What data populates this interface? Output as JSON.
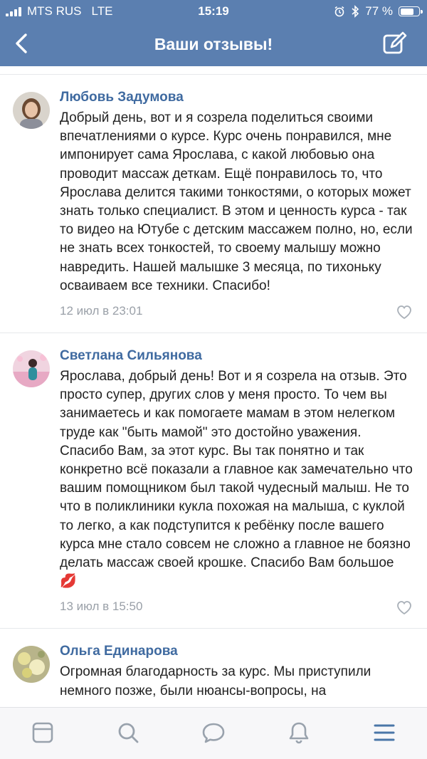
{
  "status_bar": {
    "carrier": "MTS RUS",
    "network": "LTE",
    "time": "15:19",
    "battery_percent": "77 %",
    "battery_level": 0.77
  },
  "nav": {
    "title": "Ваши отзывы!",
    "back_icon": "chevron-left-icon",
    "edit_icon": "compose-icon"
  },
  "reviews": [
    {
      "author": "Любовь Задумова",
      "text": "Добрый день, вот и я созрела поделиться своими впечатлениями о курсе. Курс очень понравился, мне импонирует сама Ярослава, с какой любовью она проводит массаж деткам. Ещё понравилось то, что Ярослава делится такими тонкостями, о которых может знать только специалист. В этом и ценность курса - так то видео на Ютубе с детским массажем полно, но, если не знать всех тонкостей, то своему малышу можно навредить. Нашей малышке 3 месяца, по тихоньку осваиваем все техники. Спасибо!",
      "date": "12 июл в 23:01"
    },
    {
      "author": "Светлана Сильянова",
      "text": "Ярослава, добрый день! Вот и я созрела на отзыв. Это просто супер, других слов у меня просто. То чем вы занимаетесь и как помогаете мамам в этом нелегком труде как \"быть мамой\" это достойно уважения. Спасибо Вам, за этот курс. Вы так понятно и так конкретно всё показали а главное как замечательно что вашим помощником был такой чудесный малыш. Не то что в поликлиники кукла похожая на малыша, с куклой то легко, а как подступится к ребёнку после вашего курса мне стало совсем не сложно а главное не боязно делать массаж своей крошке. Спасибо Вам большое 💋",
      "date": "13 июл в 15:50"
    },
    {
      "author": "Ольга Единарова",
      "text": "Огромная благодарность за курс. Мы приступили немного позже, были нюансы-вопросы, на",
      "date": ""
    }
  ],
  "tabbar": {
    "items": [
      "feed-icon",
      "search-icon",
      "messages-icon",
      "notifications-icon",
      "menu-icon"
    ],
    "active_color": "#4a76a8",
    "inactive_color": "#99a2ad"
  }
}
